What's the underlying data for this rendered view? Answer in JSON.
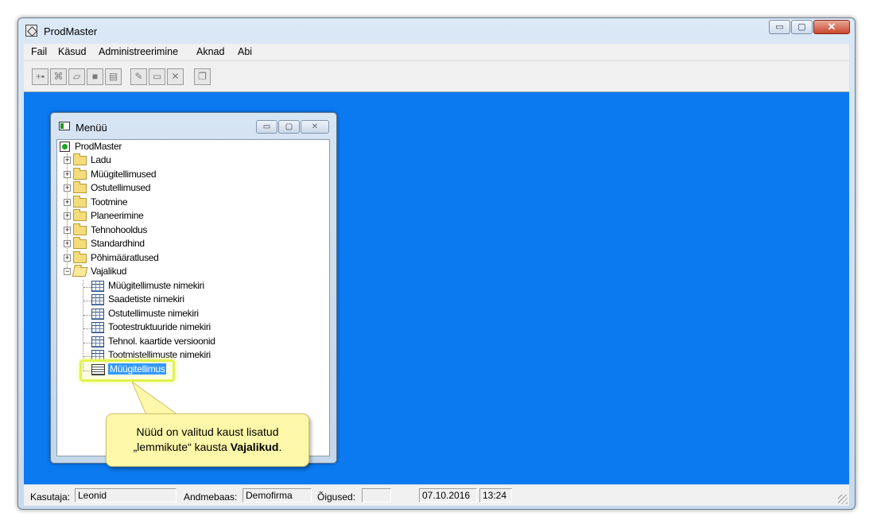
{
  "app": {
    "title": "ProdMaster",
    "window_buttons": {
      "minimize": "▭",
      "maximize": "▢",
      "close": "✕"
    }
  },
  "menu": [
    {
      "label": "Fail"
    },
    {
      "label": "Käsud"
    },
    {
      "label": "Administreerimine"
    },
    {
      "label": "Aknad"
    },
    {
      "label": "Abi"
    }
  ],
  "toolbar": {
    "buttons": [
      "new-record",
      "binoculars",
      "eraser",
      "stop",
      "document",
      "tools",
      "open",
      "delete",
      "copy-window"
    ]
  },
  "menu_window": {
    "title": "Menüü",
    "tree": {
      "root": "ProdMaster",
      "folders": [
        "Ladu",
        "Müügitellimused",
        "Ostutellimused",
        "Tootmine",
        "Planeerimine",
        "Tehnohooldus",
        "Standardhind",
        "Põhimääratlused",
        "Vajalikud"
      ],
      "favorites": [
        "Müügitellimuste nimekiri",
        "Saadetiste nimekiri",
        "Ostutellimuste nimekiri",
        "Tootestruktuuride nimekiri",
        "Tehnol. kaartide versioonid",
        "Tootmistellimuste nimekiri",
        "Müügitellimus"
      ],
      "selected": "Müügitellimus"
    }
  },
  "callout": {
    "line1": "Nüüd on valitud kaust lisatud",
    "line2_prefix": "„lemmikute“ kausta ",
    "line2_bold": "Vajalikud",
    "line2_suffix": "."
  },
  "statusbar": {
    "user_label": "Kasutaja:",
    "user_value": "Leonid",
    "db_label": "Andmebaas:",
    "db_value": "Demofirma",
    "rights_label": "Õigused:",
    "rights_value": "",
    "date": "07.10.2016",
    "time": "13:24"
  },
  "colors": {
    "desktop": "#0b79f0",
    "selection": "#3399ff",
    "callout": "#fdf7a9",
    "highlight": "#e2f24d"
  }
}
